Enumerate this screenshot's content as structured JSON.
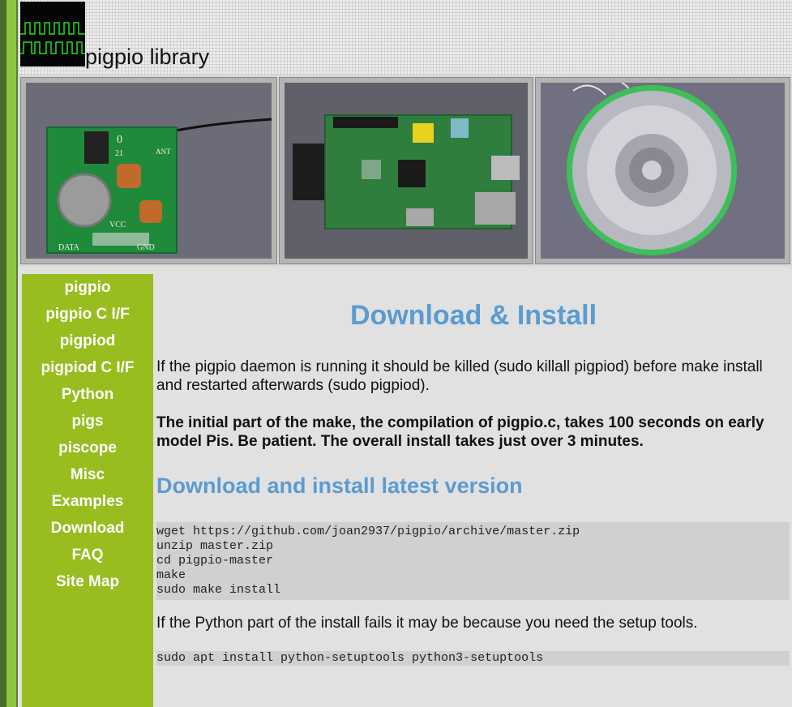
{
  "site": {
    "title": "pigpio library"
  },
  "nav": {
    "items": [
      {
        "label": "pigpio"
      },
      {
        "label": "pigpio C I/F"
      },
      {
        "label": "pigpiod"
      },
      {
        "label": "pigpiod C I/F"
      },
      {
        "label": "Python"
      },
      {
        "label": "pigs"
      },
      {
        "label": "piscope"
      },
      {
        "label": "Misc"
      },
      {
        "label": "Examples"
      },
      {
        "label": "Download"
      },
      {
        "label": "FAQ"
      },
      {
        "label": "Site Map"
      }
    ]
  },
  "photos": {
    "left_board_labels": {
      "ant": "ANT",
      "vcc": "VCC",
      "data": "DATA",
      "gnd": "GND",
      "num1": "0",
      "num2": "21"
    }
  },
  "main": {
    "title": "Download & Install",
    "para1": "If the pigpio daemon is running it should be killed (sudo killall pigpiod) before make install and restarted afterwards (sudo pigpiod).",
    "para2": "The initial part of the make, the compilation of pigpio.c, takes 100 seconds on early model Pis.  Be patient.  The overall install takes just over 3 minutes.",
    "subtitle": "Download and install latest version",
    "code1": [
      "wget https://github.com/joan2937/pigpio/archive/master.zip",
      "unzip master.zip",
      "cd pigpio-master",
      "make",
      "sudo make install"
    ],
    "para3": "If the Python part of the install fails it may be because you need the setup tools.",
    "code2": [
      "sudo apt install python-setuptools python3-setuptools"
    ]
  },
  "colors": {
    "accent_blue": "#5b9bd0",
    "sidebar_green": "#97bd1e",
    "stripe_green": "#8cc63f"
  }
}
